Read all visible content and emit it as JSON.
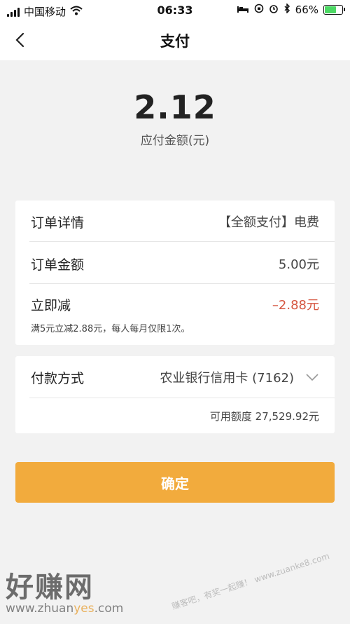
{
  "status_bar": {
    "carrier": "中国移动",
    "time": "06:33",
    "battery": "66%",
    "battery_level": 0.66
  },
  "nav": {
    "title": "支付"
  },
  "amount": {
    "value": "2.12",
    "label": "应付金额(元)"
  },
  "order": {
    "detail_label": "订单详情",
    "detail_value": "【全额支付】电费",
    "amount_label": "订单金额",
    "amount_value": "5.00元",
    "discount_label": "立即减",
    "discount_value": "–2.88元",
    "discount_note": "满5元立减2.88元，每人每月仅限1次。"
  },
  "payment": {
    "method_label": "付款方式",
    "method_value": "农业银行信用卡 (7162)",
    "available": "可用额度  27,529.92元"
  },
  "confirm_label": "确定",
  "watermark": {
    "logo_text": "好赚网",
    "url_prefix": "www.zhuan",
    "url_highlight": "yes",
    "url_suffix": ".com",
    "side_text": "赚客吧，有奖一起赚！ www.zuanke8.com"
  },
  "colors": {
    "accent": "#f2ab3d",
    "negative": "#d5553f",
    "background": "#f2f2f2"
  }
}
